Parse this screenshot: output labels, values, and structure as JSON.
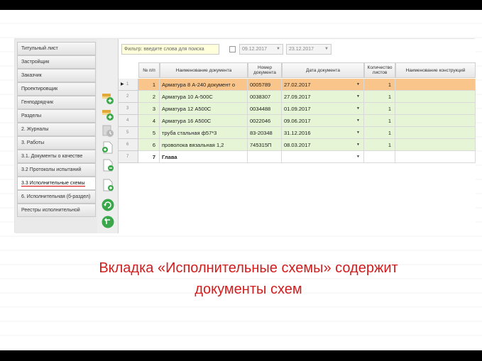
{
  "sidebar": {
    "items": [
      {
        "label": "Титульный лист"
      },
      {
        "label": "Застройщик"
      },
      {
        "label": "Заказчик"
      },
      {
        "label": "Проектировщик"
      },
      {
        "label": "Генподрядчик"
      },
      {
        "label": "Разделы"
      },
      {
        "label": "2. Журналы"
      },
      {
        "label": "3. Работы"
      },
      {
        "label": "3.1. Документы о качестве"
      },
      {
        "label": "3.2 Протоколы испытаний"
      },
      {
        "label": "3.3 Исполнительные схемы",
        "active": true
      },
      {
        "label": "6. Исполнительная (б-раздел)"
      },
      {
        "label": "Реестры исполнительной"
      }
    ]
  },
  "toolbar_icons": [
    "add-document-icon",
    "add-document-icon",
    "clock-icon",
    "document-icon",
    "document-icon",
    "document-add-icon",
    "refresh-icon",
    "back-icon"
  ],
  "filter": {
    "placeholder": "Фильтр: введите слова для поиска",
    "date_from": "09.12.2017",
    "date_to": "23.12.2017"
  },
  "table": {
    "columns": [
      "№ п/п",
      "Наименование документа",
      "Номер документа",
      "Дата документа",
      "Количество листов",
      "Наименование конструкций"
    ],
    "rows": [
      {
        "row": "1",
        "num": "1",
        "name": "Арматура 8 А-240 документ о",
        "doc_no": "0005789",
        "date": "27.02.2017",
        "sheets": "1",
        "construction": "",
        "state": "selected"
      },
      {
        "row": "2",
        "num": "2",
        "name": "Арматура 10 А-500С",
        "doc_no": "0038307",
        "date": "27.09.2017",
        "sheets": "1",
        "construction": "",
        "state": "normal"
      },
      {
        "row": "3",
        "num": "3",
        "name": "Арматура 12 А500С",
        "doc_no": "0034488",
        "date": "01.09.2017",
        "sheets": "1",
        "construction": "",
        "state": "normal"
      },
      {
        "row": "4",
        "num": "4",
        "name": "Арматура 16 А500С",
        "doc_no": "0022046",
        "date": "09.06.2017",
        "sheets": "1",
        "construction": "",
        "state": "normal"
      },
      {
        "row": "5",
        "num": "5",
        "name": "труба стальная ф57*3",
        "doc_no": "83-20348",
        "date": "31.12.2016",
        "sheets": "1",
        "construction": "",
        "state": "normal"
      },
      {
        "row": "6",
        "num": "6",
        "name": "проволока вязальная 1,2",
        "doc_no": "745315П",
        "date": "08.03.2017",
        "sheets": "1",
        "construction": "",
        "state": "normal"
      },
      {
        "row": "7",
        "num": "7",
        "name": "Глава",
        "doc_no": "",
        "date": "",
        "sheets": "",
        "construction": "",
        "state": "group"
      }
    ]
  },
  "caption": {
    "line1": "Вкладка «Исполнительные схемы» содержит",
    "line2": "документы схем"
  },
  "colors": {
    "selected_row": "#f9c58a",
    "normal_row": "#e6f5d5",
    "caption": "#d11d1d"
  }
}
